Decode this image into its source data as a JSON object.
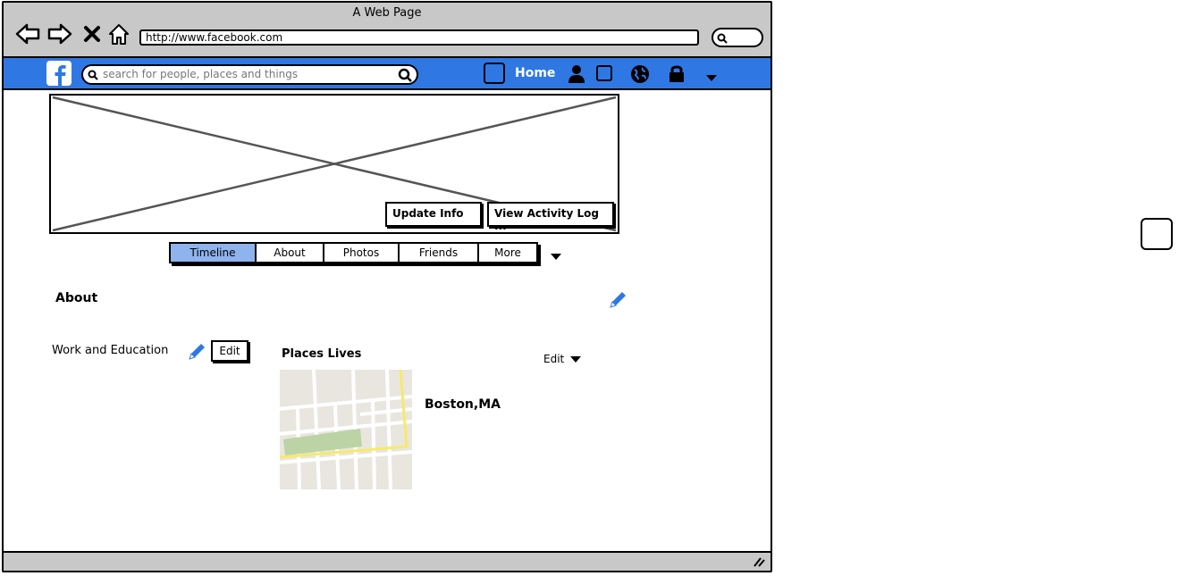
{
  "browser": {
    "title": "A Web Page",
    "url": "http://www.facebook.com"
  },
  "fb_nav": {
    "search_placeholder": "search for people, places and things",
    "home_label": "Home",
    "bar_color": "#2f78e3"
  },
  "cover": {
    "update_info_label": "Update Info",
    "view_activity_label": "View Activity Log ..."
  },
  "tabs": [
    {
      "label": "Timeline",
      "active": true
    },
    {
      "label": "About",
      "active": false
    },
    {
      "label": "Photos",
      "active": false
    },
    {
      "label": "Friends",
      "active": false
    },
    {
      "label": "More",
      "active": false
    }
  ],
  "about": {
    "title": "About",
    "work_label": "Work and Education",
    "edit_label": "Edit",
    "places_label": "Places Lives",
    "places_edit_label": "Edit",
    "city": "Boston,MA"
  }
}
